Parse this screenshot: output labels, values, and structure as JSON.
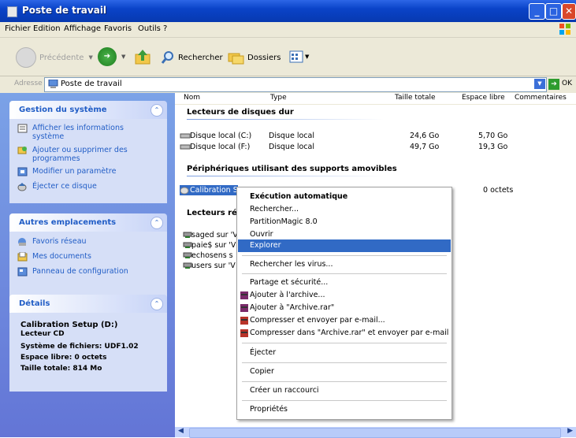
{
  "window": {
    "title": "Poste de travail"
  },
  "menu": [
    "Fichier",
    "Edition",
    "Affichage",
    "Favoris",
    "Outils",
    "?"
  ],
  "toolbar": {
    "back": "Précédente",
    "search": "Rechercher",
    "folders": "Dossiers"
  },
  "address": {
    "label": "Adresse",
    "value": "Poste de travail",
    "go": "OK"
  },
  "system_tasks": {
    "title": "Gestion du système",
    "items": [
      {
        "icon": "info-icon",
        "label": "Afficher les informations système"
      },
      {
        "icon": "add-remove-icon",
        "label": "Ajouter ou supprimer des programmes"
      },
      {
        "icon": "settings-icon",
        "label": "Modifier un paramètre"
      },
      {
        "icon": "eject-icon",
        "label": "Éjecter ce disque"
      }
    ]
  },
  "other_places": {
    "title": "Autres emplacements",
    "items": [
      {
        "icon": "network-icon",
        "label": "Favoris réseau"
      },
      {
        "icon": "documents-icon",
        "label": "Mes documents"
      },
      {
        "icon": "control-panel-icon",
        "label": "Panneau de configuration"
      }
    ]
  },
  "details": {
    "title": "Détails",
    "name": "Calibration Setup (D:)",
    "type": "Lecteur CD",
    "filesystem": "Système de fichiers: UDF1.02",
    "free": "Espace libre: 0 octets",
    "total": "Taille totale: 814 Mo"
  },
  "columns": [
    "Nom",
    "Type",
    "Taille totale",
    "Espace libre",
    "Commentaires"
  ],
  "groups": {
    "hard_disks": "Lecteurs de disques dur",
    "removable": "Périphériques utilisant des supports amovibles",
    "network": "Lecteurs rés"
  },
  "disks": [
    {
      "name": "Disque local (C:)",
      "type": "Disque local",
      "total": "24,6 Go",
      "free": "5,70 Go"
    },
    {
      "name": "Disque local (F:)",
      "type": "Disque local",
      "total": "49,7 Go",
      "free": "19,3 Go"
    }
  ],
  "removable_item": {
    "name": "Calibration S",
    "free": "0 octets"
  },
  "network_items": [
    "saged sur 'V",
    "paie$ sur 'V",
    "echosens s",
    "users sur 'V"
  ],
  "context_menu": [
    {
      "label": "Exécution automatique",
      "bold": true
    },
    {
      "label": "Rechercher..."
    },
    {
      "label": "PartitionMagic 8.0"
    },
    {
      "label": "Ouvrir"
    },
    {
      "label": "Explorer",
      "selected": true
    },
    {
      "sep": true
    },
    {
      "label": "Rechercher les virus..."
    },
    {
      "sep": true
    },
    {
      "label": "Partage et sécurité..."
    },
    {
      "label": "Ajouter à l'archive...",
      "icon": "winrar-icon"
    },
    {
      "label": "Ajouter à \"Archive.rar\"",
      "icon": "winrar-icon"
    },
    {
      "label": "Compresser et envoyer par e-mail...",
      "icon": "winrar-icon"
    },
    {
      "label": "Compresser dans \"Archive.rar\" et envoyer par e-mail",
      "icon": "winrar-icon"
    },
    {
      "sep": true
    },
    {
      "label": "Éjecter"
    },
    {
      "sep": true
    },
    {
      "label": "Copier"
    },
    {
      "sep": true
    },
    {
      "label": "Créer un raccourci"
    },
    {
      "sep": true
    },
    {
      "label": "Propriétés"
    }
  ],
  "colors": {
    "title_blue": "#0a43c8",
    "task_pane": "#6f8fdf",
    "selection": "#316ac5",
    "link": "#215dc6"
  }
}
